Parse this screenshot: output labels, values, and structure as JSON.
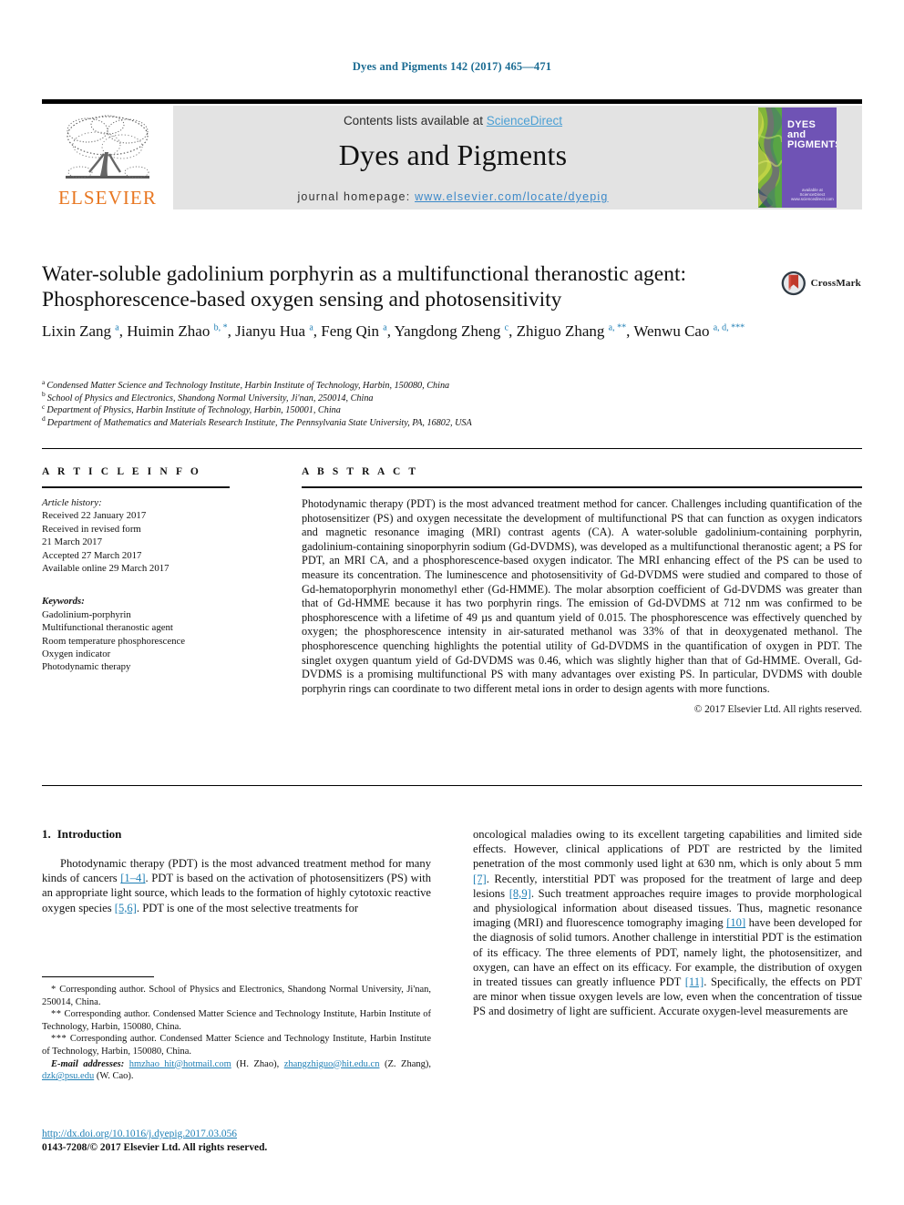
{
  "running_head": "Dyes and Pigments 142 (2017) 465—471",
  "masthead": {
    "contents_prefix": "Contents lists available at ",
    "sciencedirect": "ScienceDirect",
    "journal_name": "Dyes and Pigments",
    "homepage_label": "journal homepage: ",
    "homepage_url": "www.elsevier.com/locate/dyepig",
    "publisher_wordmark": "ELSEVIER",
    "cover_title_line1": "DYES",
    "cover_title_line2": "and",
    "cover_title_line3": "PIGMENTS",
    "cover_footer_line1": "available at",
    "cover_footer_line2": "ScienceDirect",
    "cover_footer_line3": "www.sciencedirect.com"
  },
  "article": {
    "title": "Water-soluble gadolinium porphyrin as a multifunctional theranostic agent: Phosphorescence-based oxygen sensing and photosensitivity",
    "crossmark_label": "CrossMark",
    "authors": [
      {
        "name": "Lixin Zang",
        "marks": "a"
      },
      {
        "name": "Huimin Zhao",
        "marks": "b, *"
      },
      {
        "name": "Jianyu Hua",
        "marks": "a"
      },
      {
        "name": "Feng Qin",
        "marks": "a"
      },
      {
        "name": "Yangdong Zheng",
        "marks": "c"
      },
      {
        "name": "Zhiguo Zhang",
        "marks": "a, **"
      },
      {
        "name": "Wenwu Cao",
        "marks": "a, d, ***"
      }
    ],
    "affiliations": [
      {
        "mark": "a",
        "text": "Condensed Matter Science and Technology Institute, Harbin Institute of Technology, Harbin, 150080, China"
      },
      {
        "mark": "b",
        "text": "School of Physics and Electronics, Shandong Normal University, Ji'nan, 250014, China"
      },
      {
        "mark": "c",
        "text": "Department of Physics, Harbin Institute of Technology, Harbin, 150001, China"
      },
      {
        "mark": "d",
        "text": "Department of Mathematics and Materials Research Institute, The Pennsylvania State University, PA, 16802, USA"
      }
    ]
  },
  "article_info": {
    "heading": "A R T I C L E  I N F O",
    "history_label": "Article history:",
    "history": [
      "Received 22 January 2017",
      "Received in revised form",
      "21 March 2017",
      "Accepted 27 March 2017",
      "Available online 29 March 2017"
    ],
    "keywords_label": "Keywords:",
    "keywords": [
      "Gadolinium-porphyrin",
      "Multifunctional theranostic agent",
      "Room temperature phosphorescence",
      "Oxygen indicator",
      "Photodynamic therapy"
    ]
  },
  "abstract": {
    "heading": "A B S T R A C T",
    "text": "Photodynamic therapy (PDT) is the most advanced treatment method for cancer. Challenges including quantification of the photosensitizer (PS) and oxygen necessitate the development of multifunctional PS that can function as oxygen indicators and magnetic resonance imaging (MRI) contrast agents (CA). A water-soluble gadolinium-containing porphyrin, gadolinium-containing sinoporphyrin sodium (Gd-DVDMS), was developed as a multifunctional theranostic agent; a PS for PDT, an MRI CA, and a phosphorescence-based oxygen indicator. The MRI enhancing effect of the PS can be used to measure its concentration. The luminescence and photosensitivity of Gd-DVDMS were studied and compared to those of Gd-hematoporphyrin monomethyl ether (Gd-HMME). The molar absorption coefficient of Gd-DVDMS was greater than that of Gd-HMME because it has two porphyrin rings. The emission of Gd-DVDMS at 712 nm was confirmed to be phosphorescence with a lifetime of 49 µs and quantum yield of 0.015. The phosphorescence was effectively quenched by oxygen; the phosphorescence intensity in air-saturated methanol was 33% of that in deoxygenated methanol. The phosphorescence quenching highlights the potential utility of Gd-DVDMS in the quantification of oxygen in PDT. The singlet oxygen quantum yield of Gd-DVDMS was 0.46, which was slightly higher than that of Gd-HMME. Overall, Gd-DVDMS is a promising multifunctional PS with many advantages over existing PS. In particular, DVDMS with double porphyrin rings can coordinate to two different metal ions in order to design agents with more functions.",
    "copyright": "© 2017 Elsevier Ltd. All rights reserved."
  },
  "introduction": {
    "number": "1.",
    "heading": "Introduction",
    "left_paragraph_parts": [
      {
        "t": "Photodynamic therapy (PDT) is the most advanced treatment method for many kinds of cancers ",
        "k": "text"
      },
      {
        "t": "[1–4]",
        "k": "ref"
      },
      {
        "t": ". PDT is based on the activation of photosensitizers (PS) with an appropriate light source, which leads to the formation of highly cytotoxic reactive oxygen species ",
        "k": "text"
      },
      {
        "t": "[5,6]",
        "k": "ref"
      },
      {
        "t": ". PDT is one of the most selective treatments for",
        "k": "text"
      }
    ],
    "right_paragraph_parts": [
      {
        "t": "oncological maladies owing to its excellent targeting capabilities and limited side effects. However, clinical applications of PDT are restricted by the limited penetration of the most commonly used light at 630 nm, which is only about 5 mm ",
        "k": "text"
      },
      {
        "t": "[7]",
        "k": "ref"
      },
      {
        "t": ". Recently, interstitial PDT was proposed for the treatment of large and deep lesions ",
        "k": "text"
      },
      {
        "t": "[8,9]",
        "k": "ref"
      },
      {
        "t": ". Such treatment approaches require images to provide morphological and physiological information about diseased tissues. Thus, magnetic resonance imaging (MRI) and fluorescence tomography imaging ",
        "k": "text"
      },
      {
        "t": "[10]",
        "k": "ref"
      },
      {
        "t": " have been developed for the diagnosis of solid tumors. Another challenge in interstitial PDT is the estimation of its efficacy. The three elements of PDT, namely light, the photosensitizer, and oxygen, can have an effect on its efficacy. For example, the distribution of oxygen in treated tissues can greatly influence PDT ",
        "k": "text"
      },
      {
        "t": "[11]",
        "k": "ref"
      },
      {
        "t": ". Specifically, the effects on PDT are minor when tissue oxygen levels are low, even when the concentration of tissue PS and dosimetry of light are sufficient. Accurate oxygen-level measurements are",
        "k": "text"
      }
    ]
  },
  "footnotes": {
    "corr1": "Corresponding author. School of Physics and Electronics, Shandong Normal University, Ji'nan, 250014, China.",
    "corr1_star": "*",
    "corr2": "Corresponding author. Condensed Matter Science and Technology Institute, Harbin Institute of Technology, Harbin, 150080, China.",
    "corr2_star": "**",
    "corr3": "Corresponding author. Condensed Matter Science and Technology Institute, Harbin Institute of Technology, Harbin, 150080, China.",
    "corr3_star": "***",
    "email_label": "E-mail addresses:",
    "emails": [
      {
        "addr": "hmzhao_hit@hotmail.com",
        "who": "(H. Zhao)"
      },
      {
        "addr": "zhangzhiguo@hit.edu.cn",
        "who": "(Z. Zhang)"
      },
      {
        "addr": "dzk@psu.edu",
        "who": "(W. Cao)"
      }
    ],
    "doi": "http://dx.doi.org/10.1016/j.dyepig.2017.03.056",
    "issn_line": "0143-7208/© 2017 Elsevier Ltd. All rights reserved."
  },
  "colors": {
    "link": "#1f7fb5",
    "elsevier_orange": "#E87722",
    "cover_purple": "#6f53b5",
    "masthead_grey": "#e3e3e3"
  }
}
